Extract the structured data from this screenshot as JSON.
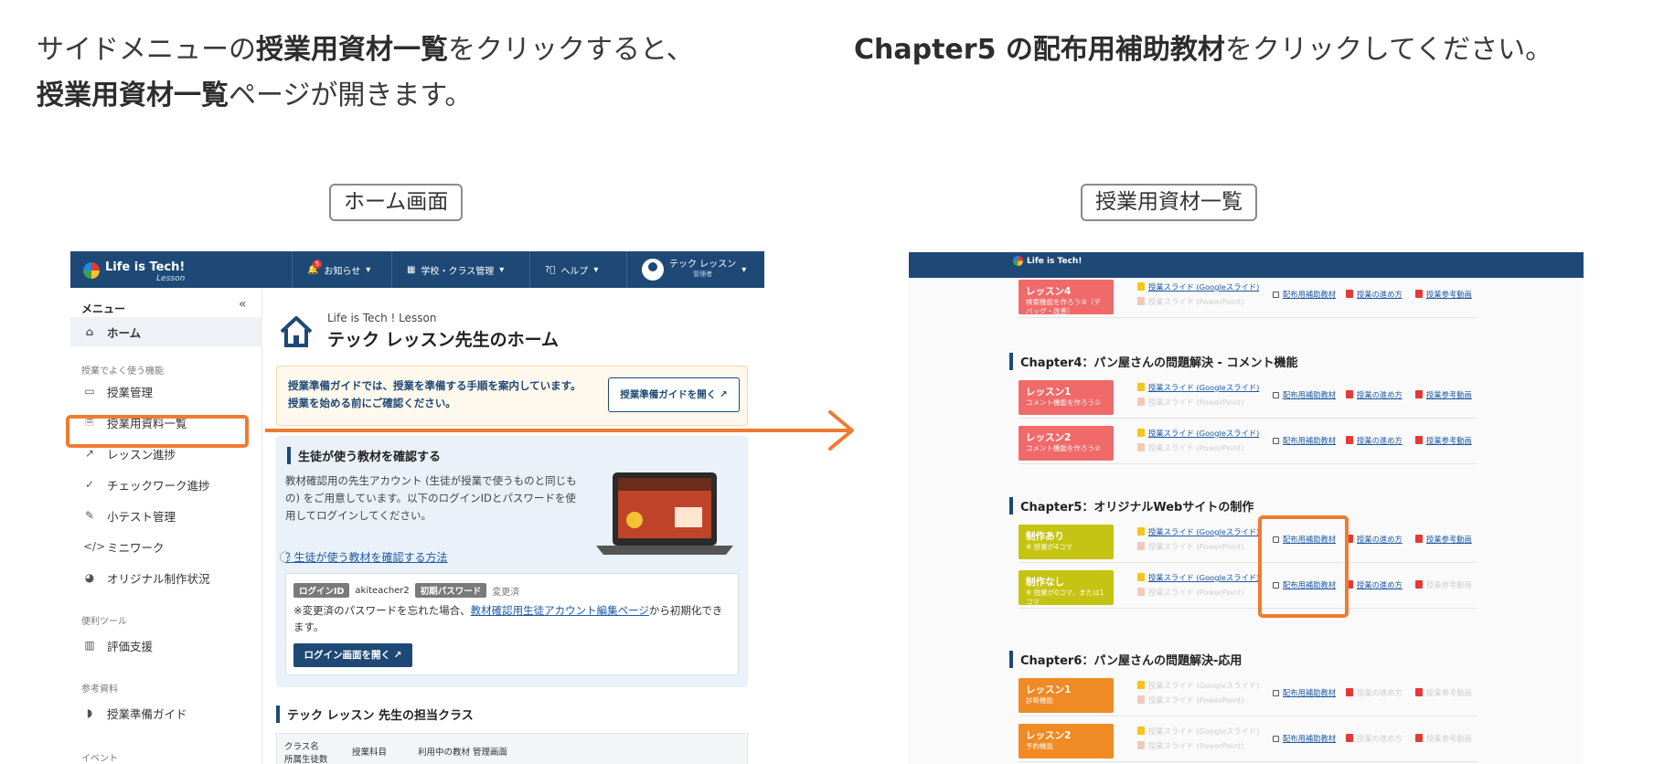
{
  "instructions": {
    "left_line1_prefix": "サイドメニューの",
    "left_line1_bold": "授業用資材一覧",
    "left_line1_suffix": "をクリックすると、",
    "left_line2_bold": "授業用資材一覧",
    "left_line2_suffix": "ページが開きます。",
    "right_bold": "Chapter5 の配布用補助教材",
    "right_suffix": "をクリックしてください。"
  },
  "captions": {
    "home": "ホーム画面",
    "materials": "授業用資材一覧"
  },
  "colors": {
    "navy": "#1e4976",
    "highlight": "#ef7b31",
    "lesson_red": "#f16a6a",
    "lesson_lime": "#c6c412",
    "lesson_orange": "#f08a24"
  },
  "home": {
    "logo_title": "Life is Tech!",
    "logo_sub": "Lesson",
    "nav": {
      "notifications": "お知らせ",
      "notifications_count": "5",
      "school": "学校・クラス管理",
      "help": "ヘルプ",
      "user_name": "テック レッスン",
      "user_role": "管理者"
    },
    "sidebar": {
      "menu_title": "メニュー",
      "home": "ホーム",
      "section_common": "授業でよく使う機能",
      "items": [
        "授業管理",
        "授業用資料一覧",
        "レッスン進捗",
        "チェックワーク進捗",
        "小テスト管理",
        "ミニワーク",
        "オリジナル制作状況"
      ],
      "section_tools": "便利ツール",
      "eval": "評価支援",
      "section_ref": "参考資料",
      "guide": "授業準備ガイド",
      "section_event": "イベント"
    },
    "main": {
      "subtitle": "Life is Tech ! Lesson",
      "title": "テック レッスン先生のホーム",
      "notice_line1": "授業準備ガイドでは、授業を準備する手順を案内しています。",
      "notice_line2": "授業を始める前にご確認ください。",
      "notice_button": "授業準備ガイドを開く",
      "panel_title": "生徒が使う教材を確認する",
      "panel_body": "教材確認用の先生アカウント (生徒が授業で使うものと同じもの) をご用意しています。以下のログインIDとパスワードを使用してログインしてください。",
      "howto_link": "生徒が使う教材を確認する方法",
      "login_id_label": "ログインID",
      "login_id": "akiteacher2",
      "init_pw_label": "初期パスワード",
      "init_pw_status": "変更済",
      "pw_note_prefix": "※変更済のパスワードを忘れた場合、",
      "pw_note_link": "教材確認用生徒アカウント編集ページ",
      "pw_note_suffix": "から初期化できます。",
      "login_button": "ログイン画面を開く",
      "classes_title": "テック レッスン 先生の担当クラス",
      "table_cols": [
        "クラス名",
        "所属生徒数",
        "授業科目",
        "利用中の教材 管理画面"
      ]
    }
  },
  "materials": {
    "logo_title": "Life is Tech!",
    "logo_sub": "Lesson",
    "resource_labels": {
      "google_slide": "授業スライド (Googleスライド)",
      "powerpoint": "授業スライド (PowerPoint)",
      "handout": "配布用補助教材",
      "guide": "授業の進め方",
      "video": "授業参考動画"
    },
    "top_lesson": {
      "name": "レッスン4",
      "desc": "検索機能を作ろう③（デバッグ・改善）"
    },
    "chapters": [
      {
        "title": "Chapter4：パン屋さんの問題解決 - コメント機能",
        "lessons": [
          {
            "name": "レッスン1",
            "desc": "コメント機能を作ろう①"
          },
          {
            "name": "レッスン2",
            "desc": "コメント機能を作ろう②"
          }
        ]
      },
      {
        "title": "Chapter5：オリジナルWebサイトの制作",
        "lessons": [
          {
            "name": "制作あり",
            "desc": "※ 授業が4コマ"
          },
          {
            "name": "制作なし",
            "desc": "※ 授業が0コマ、または1コマ"
          }
        ]
      },
      {
        "title": "Chapter6：パン屋さんの問題解決-応用",
        "lessons": [
          {
            "name": "レッスン1",
            "desc": "診断機能"
          },
          {
            "name": "レッスン2",
            "desc": "予約機能"
          }
        ]
      }
    ]
  }
}
